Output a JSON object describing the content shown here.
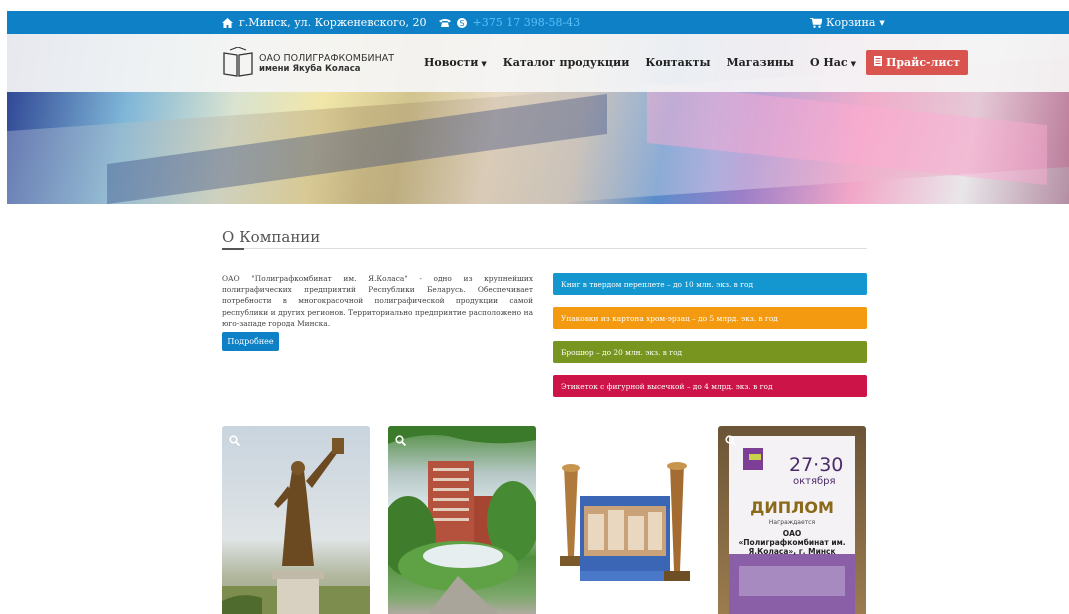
{
  "topbar": {
    "address": "г.Минск, ул. Корженевского, 20",
    "phone": "+375 17 398-58-43",
    "cart": "Корзина",
    "icons": [
      "home-icon",
      "phone-icon",
      "skype-icon",
      "cart-icon"
    ]
  },
  "logo": {
    "line1": "ОАО ПОЛИГРАФКОМБИНАТ",
    "line2": "имени Якуба Коласа"
  },
  "menu": {
    "news": "Новости",
    "catalog": "Каталог продукции",
    "contacts": "Контакты",
    "shops": "Магазины",
    "about": "О Нас",
    "price": "Прайс-лист"
  },
  "about_section": {
    "title": "О Компании",
    "text": "ОАО \"Полиграфкомбинат им. Я.Коласа\" - одно из крупнейших полиграфических предприятий Республики Беларусь. Обеспечивает потребности в многокрасочной полиграфической продукции самой республики и других регионов. Территориально предприятие расположено на юго-западе города Минска.",
    "more": "Подробнее"
  },
  "stats": [
    {
      "text": "Книг в твердом переплете – до 10 млн. экз. в год",
      "color": "#1496cf"
    },
    {
      "text": "Упаковки из картона хром-эрзац – до 5 млрд. экз. в год",
      "color": "#f39a11"
    },
    {
      "text": "Брошюр – до 20 млн. экз. в год",
      "color": "#77951f"
    },
    {
      "text": "Этикеток с фигурной высечкой – до 4 млрд. экз. в год",
      "color": "#cd1448"
    }
  ],
  "diploma": {
    "days": "27·30",
    "month": "октября",
    "title": "ДИПЛОМ",
    "sub": "Награждается",
    "org": "ОАО «Полиграфкомбинат им. Я.Коласа», г. Минск"
  }
}
